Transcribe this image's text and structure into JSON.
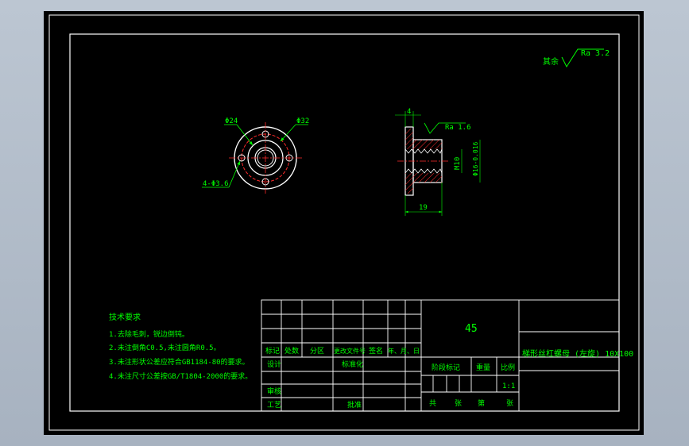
{
  "roughness_note": {
    "label": "其余",
    "value": "Ra 3.2"
  },
  "front_view": {
    "dim_inner_circle": "Φ24",
    "dim_bolt_circle": "Φ32",
    "dim_holes": "4-Φ3.6"
  },
  "side_view": {
    "dim_flange_thickness": "4",
    "roughness": "Ra 1.6",
    "dim_thread": "M10",
    "dim_outer_diameter": "Φ16-0.016",
    "dim_length": "19"
  },
  "tech_requirements": {
    "title": "技术要求",
    "items": [
      "1.去除毛刺，锐边倒钝。",
      "2.未注倒角C0.5,未注圆角R0.5。",
      "3.未注形状公差应符合GB1184-80的要求。",
      "4.未注尺寸公差按GB/T1804-2000的要求。"
    ]
  },
  "title_block": {
    "material": "45",
    "drawing_name": "梯形丝杠螺母 (左旋) 10X100",
    "scale_value": "1:1",
    "headers": {
      "mark": "标记",
      "count": "处数",
      "zone": "分区",
      "change_doc": "更改文件号",
      "signature": "签名",
      "date": "年、月、日",
      "design": "设计",
      "standardize": "标准化",
      "review": "审核",
      "process": "工艺",
      "approve": "批准",
      "stage_mark": "阶段标记",
      "weight": "重量",
      "scale": "比例",
      "total": "共",
      "sheets": "张",
      "page": "第",
      "sheet": "张"
    }
  },
  "colors": {
    "background": "#000000",
    "frame": "#ffffff",
    "text": "#00ff00",
    "hidden": "#ff2b2b",
    "dimension": "#00ff00",
    "part": "#ffffff",
    "hatch": "#ff2b2b"
  }
}
